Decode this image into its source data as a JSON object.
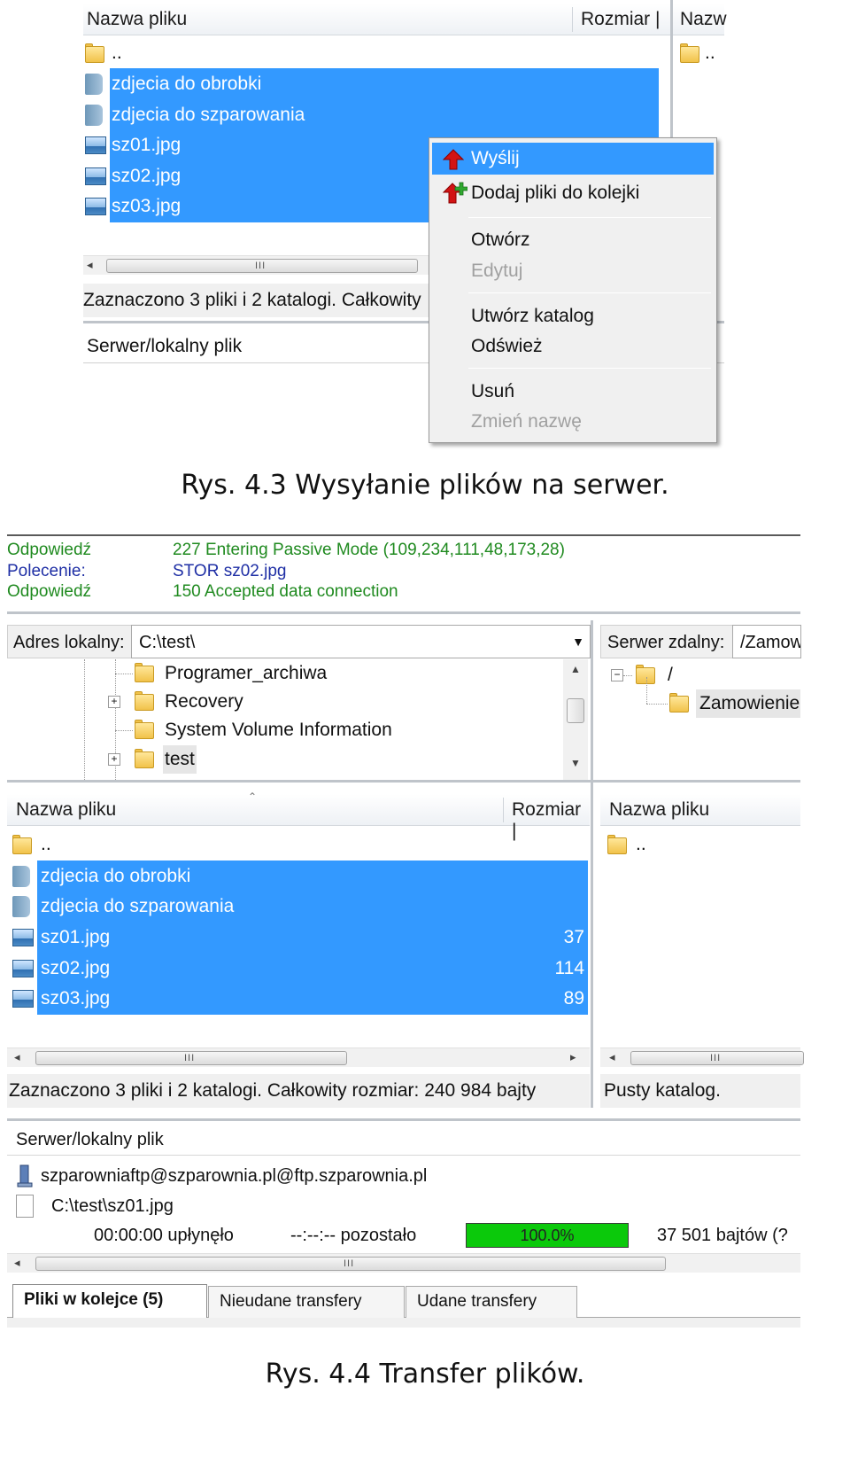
{
  "fig1": {
    "header": {
      "name": "Nazwa pliku",
      "size": "Rozmiar |",
      "remote": "Nazw"
    },
    "rows": [
      {
        "name": "..",
        "type": "folder",
        "selected": false
      },
      {
        "name": "zdjecia do obrobki",
        "type": "dir",
        "selected": true
      },
      {
        "name": "zdjecia do szparowania",
        "type": "dir",
        "selected": true
      },
      {
        "name": "sz01.jpg",
        "type": "image",
        "selected": true
      },
      {
        "name": "sz02.jpg",
        "type": "image",
        "selected": true
      },
      {
        "name": "sz03.jpg",
        "type": "image",
        "selected": true
      }
    ],
    "remote_up": "..",
    "status": "Zaznaczono 3 pliki i 2 katalogi. Całkowity",
    "queue_header": "Serwer/lokalny plik",
    "menu": {
      "send": "Wyślij",
      "add_queue": "Dodaj pliki do kolejki",
      "open": "Otwórz",
      "edit": "Edytuj",
      "create_dir": "Utwórz katalog",
      "refresh": "Odśwież",
      "delete": "Usuń",
      "rename": "Zmień nazwę"
    },
    "caption": "Rys. 4.3 Wysyłanie plików na serwer."
  },
  "fig2": {
    "log": [
      {
        "key": "Odpowiedź",
        "value": "227 Entering Passive Mode (109,234,111,48,173,28)",
        "color": "#1f8a1f"
      },
      {
        "key": "Polecenie:",
        "value": "STOR sz02.jpg",
        "color": "#1f2fa5"
      },
      {
        "key": "Odpowiedź",
        "value": "150 Accepted data connection",
        "color": "#1f8a1f"
      }
    ],
    "local_addr_label": "Adres lokalny:",
    "local_addr_value": "C:\\test\\",
    "remote_addr_label": "Serwer zdalny:",
    "remote_addr_value": "/Zamow",
    "local_tree": [
      "Programer_archiwa",
      "Recovery",
      "System Volume Information",
      "test"
    ],
    "remote_tree": [
      "/",
      "Zamowienie"
    ],
    "header": {
      "name": "Nazwa pliku",
      "size": "Rozmiar |"
    },
    "remote_header": "Nazwa pliku",
    "rows": [
      {
        "name": "..",
        "size": "",
        "type": "folder",
        "selected": false
      },
      {
        "name": "zdjecia do obrobki",
        "size": "",
        "type": "dir",
        "selected": true
      },
      {
        "name": "zdjecia do szparowania",
        "size": "",
        "type": "dir",
        "selected": true
      },
      {
        "name": "sz01.jpg",
        "size": "37",
        "type": "image",
        "selected": true
      },
      {
        "name": "sz02.jpg",
        "size": "114",
        "type": "image",
        "selected": true
      },
      {
        "name": "sz03.jpg",
        "size": "89",
        "type": "image",
        "selected": true
      }
    ],
    "remote_up": "..",
    "status_local": "Zaznaczono 3 pliki i 2 katalogi. Całkowity rozmiar: 240 984 bajty",
    "status_remote": "Pusty katalog.",
    "queue_header": "Serwer/lokalny plik",
    "queue_server": "szparowniaftp@szparownia.pl@ftp.szparownia.pl",
    "queue_file": "C:\\test\\sz01.jpg",
    "elapsed": "00:00:00 upłynęło",
    "remaining": "--:--:-- pozostało",
    "progress_label": "100.0%",
    "progress": 1.0,
    "bytes": "37 501 bajtów (?",
    "tabs": [
      "Pliki w kolejce (5)",
      "Nieudane transfery",
      "Udane transfery"
    ],
    "caption": "Rys. 4.4 Transfer plików."
  },
  "colors": {
    "selection": "#3399ff",
    "progress": "#0bc90b",
    "log_response": "#1f8a1f",
    "log_command": "#1f2fa5"
  }
}
